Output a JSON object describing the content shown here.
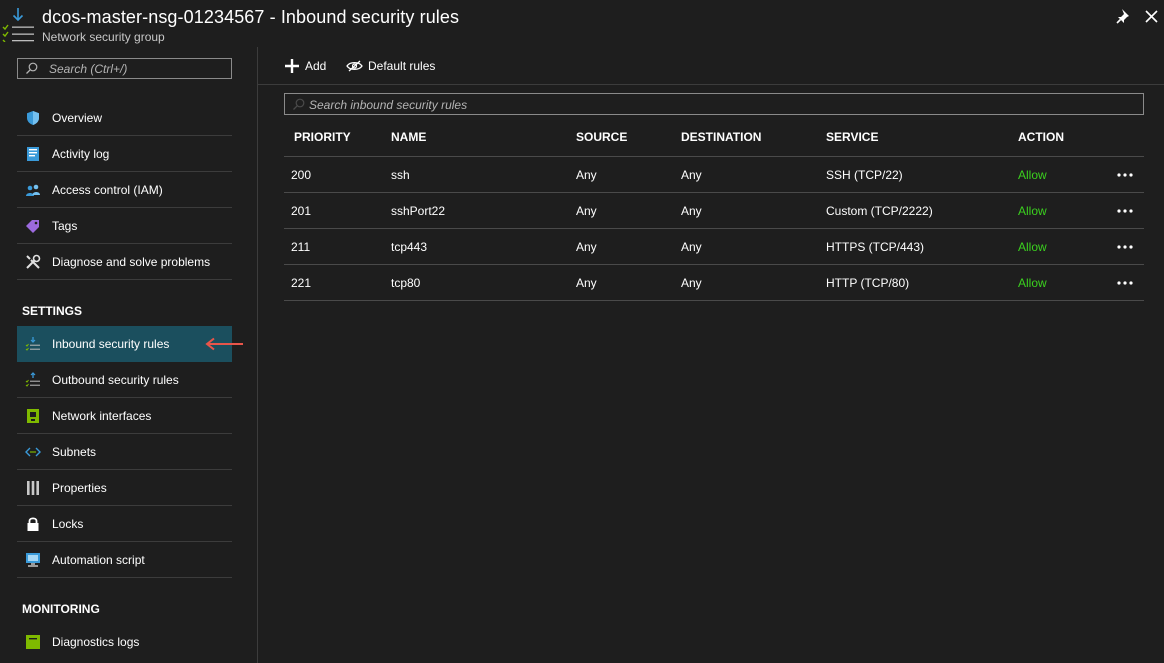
{
  "header": {
    "title": "dcos-master-nsg-01234567 - Inbound security rules",
    "subtitle": "Network security group"
  },
  "sidebar": {
    "search_placeholder": "Search (Ctrl+/)",
    "items": [
      {
        "label": "Overview",
        "icon": "shield-icon"
      },
      {
        "label": "Activity log",
        "icon": "activity-log-icon"
      },
      {
        "label": "Access control (IAM)",
        "icon": "people-icon"
      },
      {
        "label": "Tags",
        "icon": "tag-icon"
      },
      {
        "label": "Diagnose and solve problems",
        "icon": "wrench-icon"
      }
    ],
    "settings_label": "SETTINGS",
    "settings_items": [
      {
        "label": "Inbound security rules",
        "icon": "inbound-rules-icon",
        "selected": true
      },
      {
        "label": "Outbound security rules",
        "icon": "outbound-rules-icon"
      },
      {
        "label": "Network interfaces",
        "icon": "network-interface-icon"
      },
      {
        "label": "Subnets",
        "icon": "subnets-icon"
      },
      {
        "label": "Properties",
        "icon": "properties-icon"
      },
      {
        "label": "Locks",
        "icon": "lock-icon"
      },
      {
        "label": "Automation script",
        "icon": "automation-icon"
      }
    ],
    "monitoring_label": "MONITORING",
    "monitoring_items": [
      {
        "label": "Diagnostics logs",
        "icon": "diagnostics-icon"
      }
    ]
  },
  "toolbar": {
    "add_label": "Add",
    "default_rules_label": "Default rules"
  },
  "rules_search_placeholder": "Search inbound security rules",
  "table": {
    "columns": [
      "PRIORITY",
      "NAME",
      "SOURCE",
      "DESTINATION",
      "SERVICE",
      "ACTION"
    ],
    "rows": [
      {
        "priority": "200",
        "name": "ssh",
        "source": "Any",
        "destination": "Any",
        "service": "SSH (TCP/22)",
        "action": "Allow"
      },
      {
        "priority": "201",
        "name": "sshPort22",
        "source": "Any",
        "destination": "Any",
        "service": "Custom (TCP/2222)",
        "action": "Allow"
      },
      {
        "priority": "211",
        "name": "tcp443",
        "source": "Any",
        "destination": "Any",
        "service": "HTTPS (TCP/443)",
        "action": "Allow"
      },
      {
        "priority": "221",
        "name": "tcp80",
        "source": "Any",
        "destination": "Any",
        "service": "HTTP (TCP/80)",
        "action": "Allow"
      }
    ]
  },
  "colors": {
    "background": "#1e1e1e",
    "selected_nav": "#1b4f5e",
    "allow": "#3bd11e",
    "arrow": "#e8554a"
  }
}
